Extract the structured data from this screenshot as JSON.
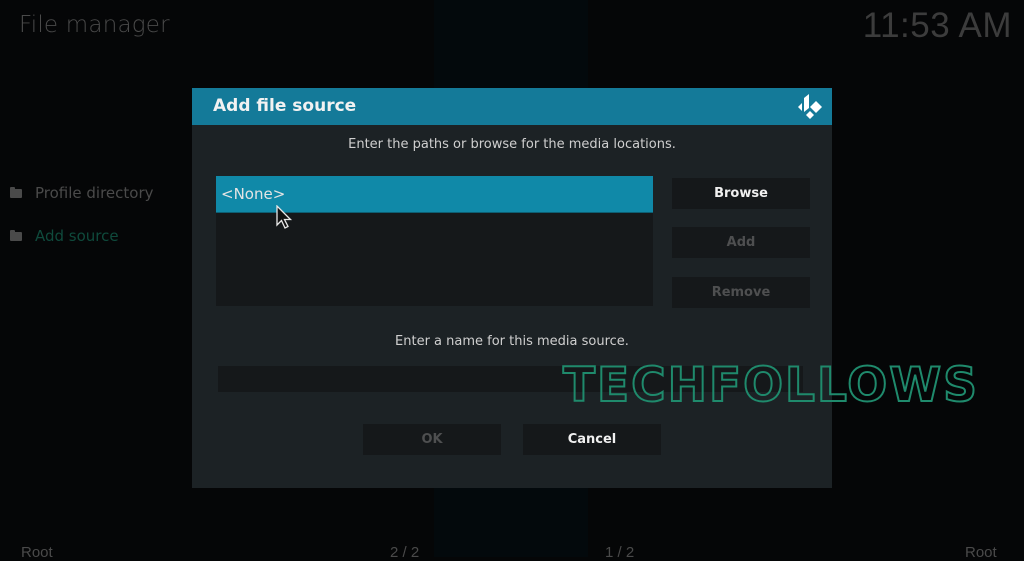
{
  "app": {
    "page_title": "File manager",
    "clock": "11:53 AM"
  },
  "sidebar": {
    "items": [
      {
        "label": "Profile directory",
        "icon": "folder-icon",
        "active": false
      },
      {
        "label": "Add source",
        "icon": "folder-icon",
        "active": true
      }
    ]
  },
  "footer": {
    "left_root": "Root",
    "left_count": "2 / 2",
    "right_count": "1 / 2",
    "right_root": "Root"
  },
  "dialog": {
    "title": "Add file source",
    "logo_icon": "kodi-logo-icon",
    "paths_instruction": "Enter the paths or browse for the media locations.",
    "paths": [
      {
        "label": "<None>",
        "selected": true
      }
    ],
    "buttons": {
      "browse": "Browse",
      "add": "Add",
      "remove": "Remove",
      "ok": "OK",
      "cancel": "Cancel"
    },
    "name_instruction": "Enter a name for this media source.",
    "name_value": "",
    "name_placeholder": ""
  },
  "watermark": {
    "text": "TECHFOLLOWS"
  },
  "colors": {
    "header_accent": "#147a99",
    "selected_item": "#1089a8",
    "dialog_bg": "#1c2225",
    "active_sidebar_text": "#0f4a3c",
    "watermark": "#1f8a6c"
  }
}
